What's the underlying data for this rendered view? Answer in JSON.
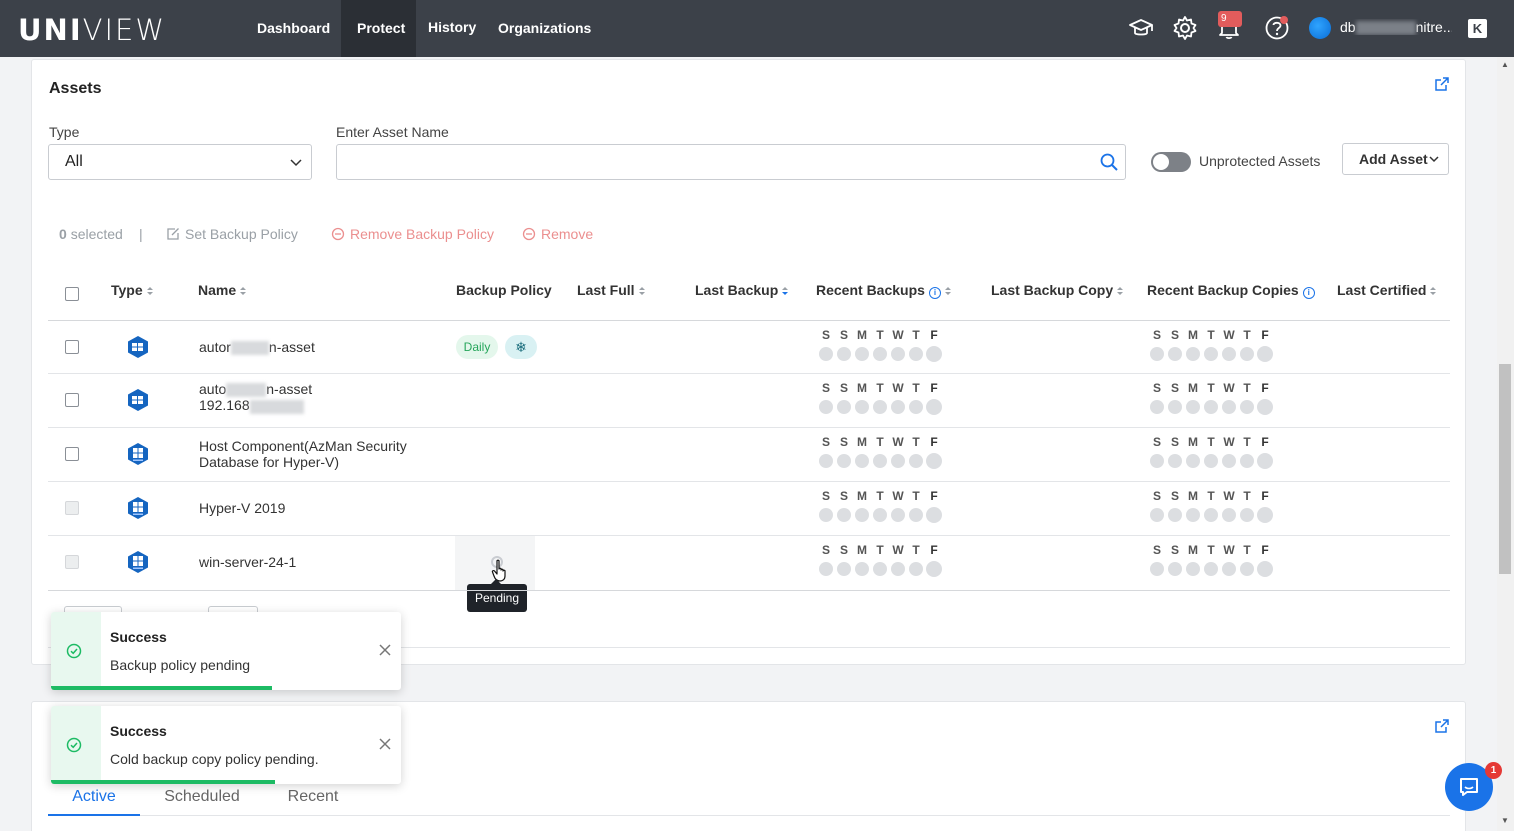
{
  "nav": {
    "logo": "UNIVIEW",
    "tabs": [
      "Dashboard",
      "Protect",
      "History",
      "Organizations"
    ],
    "active_tab": "Protect",
    "bell_count": "9",
    "user_prefix": "db",
    "user_suffix": "nitre..."
  },
  "assets": {
    "title": "Assets",
    "type_label": "Type",
    "type_value": "All",
    "search_label": "Enter Asset Name",
    "search_value": "",
    "toggle_label": "Unprotected Assets",
    "add_asset_label": "Add Asset",
    "bulk": {
      "selected_count": "0",
      "selected_label": "selected",
      "separator": "|",
      "set_policy": "Set Backup Policy",
      "remove_policy": "Remove Backup Policy",
      "remove": "Remove"
    },
    "columns": [
      "Type",
      "Name",
      "Backup Policy",
      "Last Full",
      "Last Backup",
      "Recent Backups",
      "Last Backup Copy",
      "Recent Backup Copies",
      "Last Certified"
    ],
    "day_letters": [
      "S",
      "S",
      "M",
      "T",
      "W",
      "T",
      "F"
    ],
    "rows": [
      {
        "name_pre": "autor",
        "name_post": "n-asset",
        "sub_pre": "",
        "policy": "Daily",
        "has_snow": true,
        "type_icon": "windows-icon"
      },
      {
        "name_pre": "auto",
        "name_post": "n-asset",
        "sub_pre": "192.168",
        "policy": "",
        "has_snow": false,
        "type_icon": "windows-icon"
      },
      {
        "name_pre": "Host Component(AzMan Security",
        "name_post": "",
        "sub_pre": "Database for Hyper-V)",
        "policy": "",
        "has_snow": false,
        "type_icon": "hyperv-icon"
      },
      {
        "name_pre": "Hyper-V 2019",
        "name_post": "",
        "sub_pre": "",
        "policy": "",
        "has_snow": false,
        "type_icon": "hyperv-icon"
      },
      {
        "name_pre": "win-server-24-1",
        "name_post": "",
        "sub_pre": "",
        "policy": "",
        "has_snow": false,
        "type_icon": "hyperv-icon"
      }
    ],
    "tooltip": "Pending"
  },
  "toasts": [
    {
      "title": "Success",
      "message": "Backup policy pending",
      "progress": 0.63
    },
    {
      "title": "Success",
      "message": "Cold backup copy policy pending.",
      "progress": 0.64
    }
  ],
  "jobs": {
    "tabs": [
      "Active",
      "Scheduled",
      "Recent"
    ],
    "active_tab": "Active"
  },
  "chat_badge": "1",
  "colors": {
    "nav_bg": "#3c4149",
    "accent": "#1a73e8",
    "success": "#1dbb64",
    "danger": "#e86a6a"
  }
}
